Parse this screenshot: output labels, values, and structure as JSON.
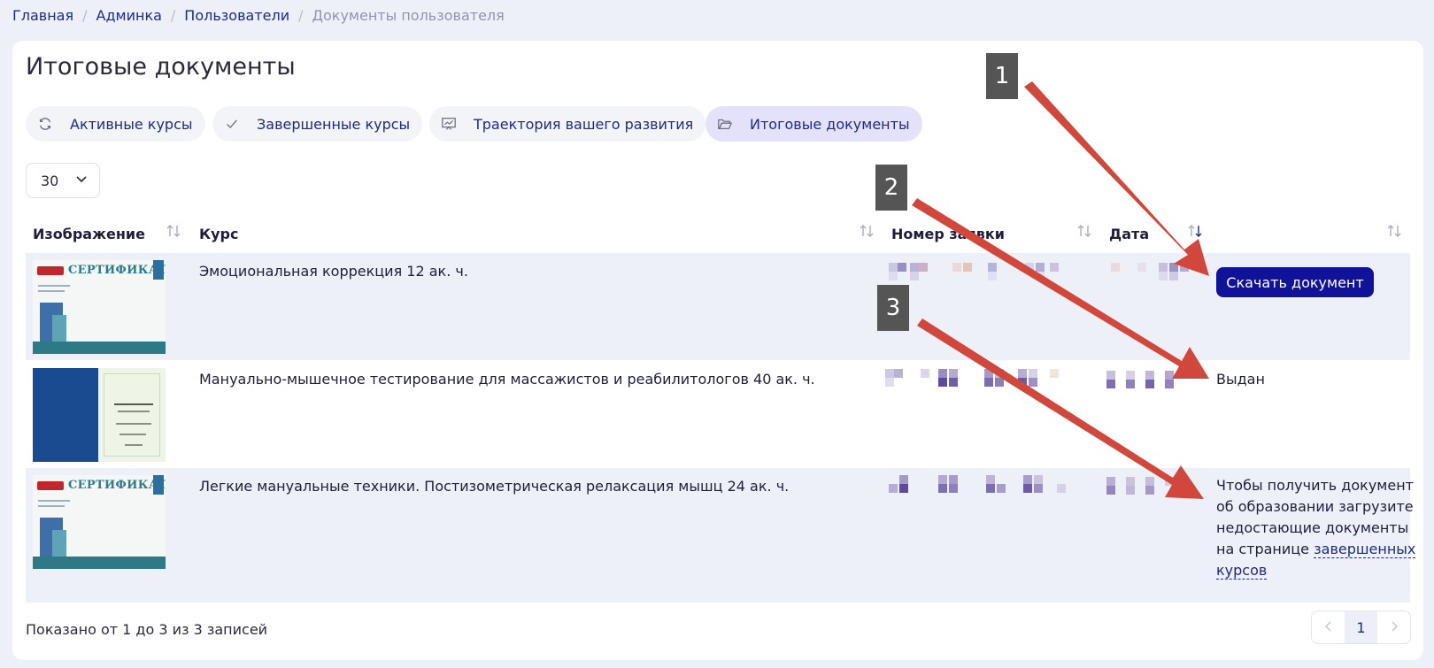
{
  "breadcrumb": {
    "items": [
      "Главная",
      "Админка",
      "Пользователи"
    ],
    "current": "Документы пользователя"
  },
  "page_title": "Итоговые документы",
  "tabs": [
    {
      "label": "Активные курсы",
      "icon": "refresh-icon",
      "active": false
    },
    {
      "label": "Завершенные курсы",
      "icon": "check-icon",
      "active": false
    },
    {
      "label": "Траектория вашего развития",
      "icon": "chart-board-icon",
      "active": false
    },
    {
      "label": "Итоговые документы",
      "icon": "folder-open-icon",
      "active": true
    }
  ],
  "page_size": {
    "value": "30"
  },
  "table": {
    "columns": [
      "Изображение",
      "Курс",
      "Номер заявки",
      "Дата",
      ""
    ],
    "rows": [
      {
        "image": "certificate",
        "certificate_title": "СЕРТИФИКАТ",
        "course": "Эмоциональная коррекция 12 ак. ч.",
        "action": {
          "type": "button",
          "label": "Скачать документ"
        }
      },
      {
        "image": "diploma",
        "course": "Мануально-мышечное тестирование для массажистов и реабилитологов 40 ак. ч.",
        "action": {
          "type": "status",
          "label": "Выдан"
        }
      },
      {
        "image": "certificate",
        "certificate_title": "СЕРТИФИКАТ",
        "course": "Легкие мануальные техники. Постизометрическая релаксация мышц 24 ак. ч.",
        "action": {
          "type": "text",
          "lines": [
            "Чтобы получить документ",
            "об образовании загрузите",
            "недостающие документы",
            "на странице"
          ],
          "link_part1": "завершенных",
          "link_part2": "курсов"
        }
      }
    ]
  },
  "footer": {
    "info": "Показано от 1 до 3 из 3 записей"
  },
  "pagination": {
    "current": "1"
  },
  "annotations": [
    "1",
    "2",
    "3"
  ],
  "colors": {
    "accent": "#10129a",
    "link": "#1d2a8a",
    "tab_active_bg": "#e4e2fb",
    "annotation_arrow": "#d2473c",
    "annotation_box": "#555555"
  }
}
